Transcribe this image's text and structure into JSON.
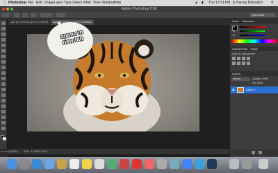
{
  "menubar": {
    "app": "Photoshop",
    "items": [
      "File",
      "Edit",
      "Image",
      "Layer",
      "Type",
      "Select",
      "Filter",
      "View",
      "Window",
      "Help"
    ],
    "time": "Thu 12:51 PM",
    "user": "E Harvey Bolsopho"
  },
  "window": {
    "title": "Adobe Photoshop CS6"
  },
  "options": {
    "workspace": "Essentials"
  },
  "tabs": [
    {
      "label": "gal @ 100% (Layer 1, RGB/8)"
    },
    {
      "label": "tiger @ 100% (Layer 0, RGB/8)"
    }
  ],
  "callout": {
    "text": "opens in new tab"
  },
  "status": {
    "zoom": "100%",
    "doc": "Doc: 1.21M/1.21M",
    "bottom_tab": "Mini Bridge"
  },
  "panels": {
    "color_title": "Color",
    "swatches_title": "Swatches",
    "channels": [
      "R",
      "G",
      "B"
    ],
    "adjustments_title": "Adjustments",
    "adjustments_sub": "Add an adjustment",
    "styles_title": "Styles",
    "layers_title": "Layers",
    "layers_blend": "Normal",
    "layers_opacity": "Opacity: 100%",
    "layers_fill": "Fill: 100%",
    "layer_name": "Layer 0"
  },
  "colors": {
    "accent": "#2b6fd6",
    "panel": "#3c3c3c",
    "canvas": "#1f1f1f"
  }
}
